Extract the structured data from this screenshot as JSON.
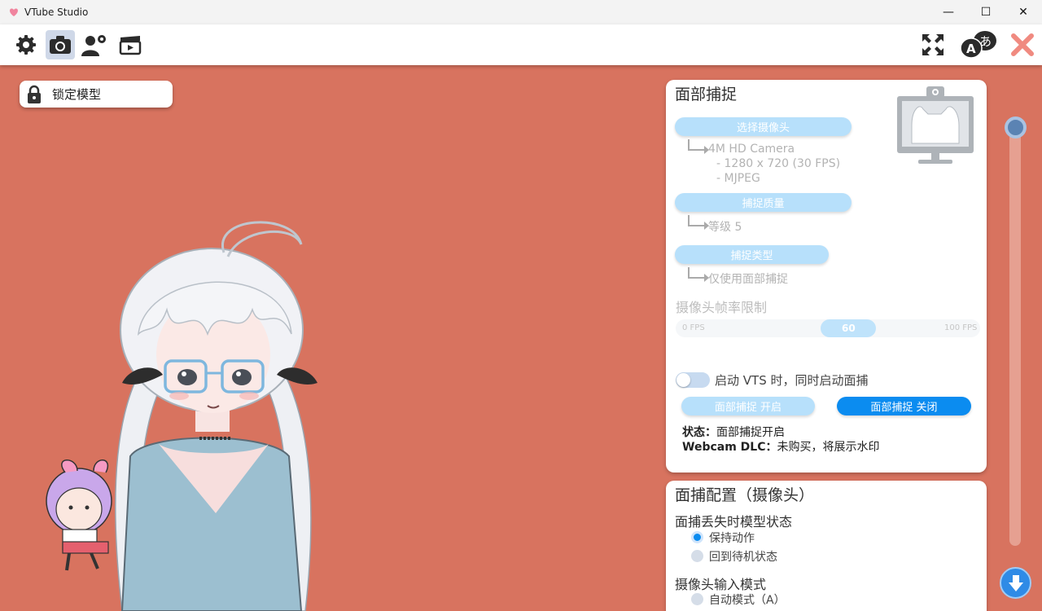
{
  "window": {
    "title": "VTube Studio",
    "minimize": "—",
    "maximize": "☐",
    "close": "✕"
  },
  "lock": {
    "label": "锁定模型"
  },
  "face_capture": {
    "title": "面部捕捉",
    "select_camera": "选择摄像头",
    "camera_name": "4M HD Camera",
    "camera_res": "- 1280 x 720 (30 FPS)",
    "camera_format": "- MJPEG",
    "quality_btn": "捕捉质量",
    "quality_value": "等级 5",
    "type_btn": "捕捉类型",
    "type_value": "仅使用面部捕捉",
    "fps_label": "摄像头帧率限制",
    "fps_min": "0 FPS",
    "fps_value": "60",
    "fps_max": "100 FPS",
    "fps_level": 0.6,
    "autostart_label": "启动 VTS 时，同时启动面捕",
    "start_btn": "面部捕捉 开启",
    "stop_btn": "面部捕捉 关闭",
    "status_key": "状态：",
    "status_value": "面部捕捉开启",
    "dlc_key": "Webcam DLC：",
    "dlc_value": "未购买，将展示水印"
  },
  "config": {
    "title": "面捕配置（摄像头）",
    "lost_label": "面捕丢失时模型状态",
    "opt_keep": "保持动作",
    "opt_idle": "回到待机状态",
    "input_label": "摄像头输入模式",
    "opt_auto": "自动模式（A）"
  },
  "colors": {
    "background": "#d8735f",
    "accent": "#0b8cf0",
    "pill_light": "#b7e0fb"
  },
  "icons": [
    "settings-icon",
    "camera-icon",
    "user-settings-icon",
    "video-clapper-icon",
    "fullscreen-icon",
    "language-icon",
    "close-app-icon",
    "lock-icon",
    "webcam-monitor-icon",
    "arrow-down-icon"
  ]
}
